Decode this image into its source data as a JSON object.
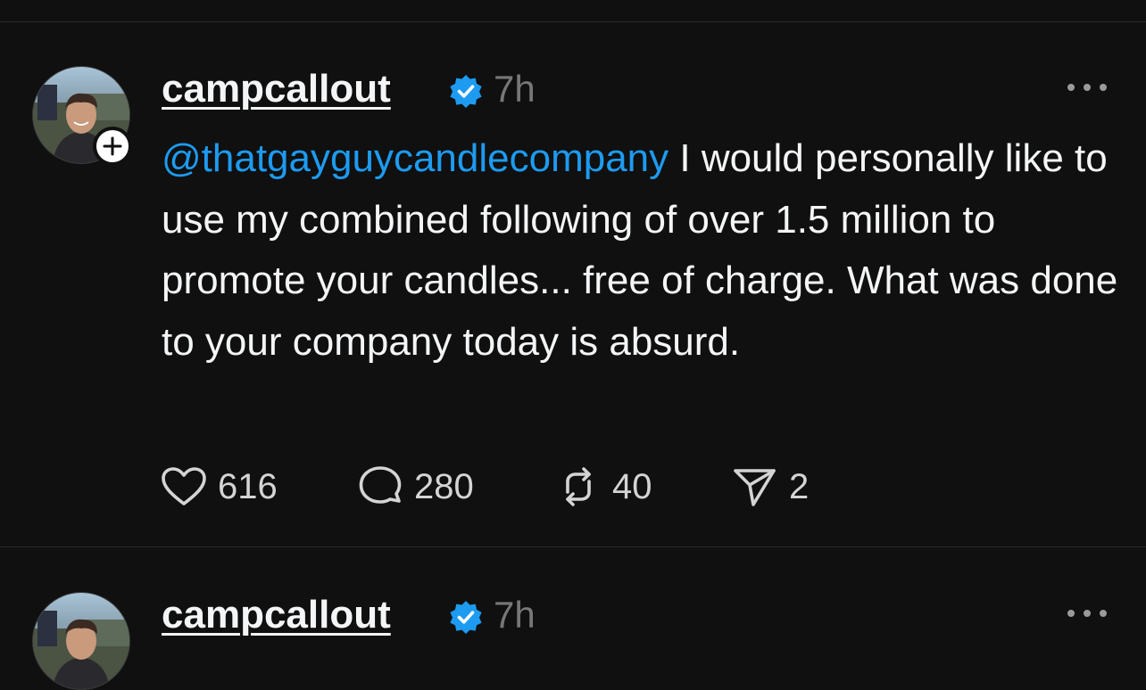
{
  "posts": [
    {
      "username": "campcallout",
      "timestamp": "7h",
      "mention": "@thatgayguycandlecompany",
      "body": " I would personally like to use my combined following of over 1.5 million to promote your candles... free of charge. What was done to your company today is absurd.",
      "counts": {
        "likes": "616",
        "replies": "280",
        "reposts": "40",
        "shares": "2"
      }
    },
    {
      "username": "campcallout",
      "timestamp": "7h"
    }
  ],
  "colors": {
    "background": "#101010",
    "text": "#f3f5f7",
    "muted": "#777777",
    "mention": "#1d9bf0",
    "verified": "#1d9bf0"
  },
  "icons": {
    "verified": "verified-badge-icon",
    "follow": "plus-icon",
    "more": "more-horizontal-icon",
    "like": "heart-icon",
    "reply": "comment-bubble-icon",
    "repost": "repost-icon",
    "share": "send-icon"
  }
}
